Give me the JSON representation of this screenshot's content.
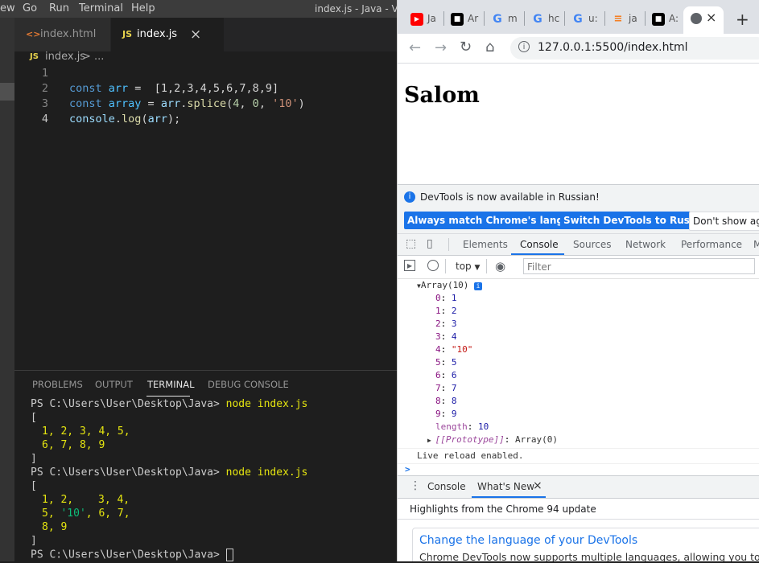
{
  "vscode": {
    "menu": [
      "ew",
      "Go",
      "Run",
      "Terminal",
      "Help"
    ],
    "window_title": "index.js - Java - Visual Studio Code",
    "tabs": [
      {
        "icon": "<>",
        "label": "index.html"
      },
      {
        "icon": "JS",
        "label": "index.js",
        "close": "×"
      }
    ],
    "breadcrumb": {
      "icon": "JS",
      "file": "index.js",
      "rest": " > ..."
    },
    "editor": {
      "line_numbers": [
        "1",
        "2",
        "3",
        "4"
      ],
      "line2": {
        "kw": "const",
        "var": "arr",
        "eq": " =  ",
        "value": "[1,2,3,4,5,6,7,8,9]"
      },
      "line3": {
        "kw": "const",
        "var": "array",
        "eq": " = ",
        "obj": "arr",
        "dot": ".",
        "fn": "splice",
        "args_open": "(",
        "a1": "4",
        "sep1": ", ",
        "a2": "0",
        "sep2": ", ",
        "a3": "'10'",
        "args_close": ")"
      },
      "line4": {
        "obj": "console",
        "dot": ".",
        "fn": "log",
        "open": "(",
        "arg": "arr",
        "close": ");"
      }
    },
    "panel_tabs": [
      "PROBLEMS",
      "OUTPUT",
      "TERMINAL",
      "DEBUG CONSOLE"
    ],
    "terminal": {
      "prompt": "PS C:\\Users\\User\\Desktop\\Java> ",
      "command": "node index.js",
      "open_bracket": "[",
      "close_bracket": "]",
      "run1_row1": "1, 2, 3, 4, 5,",
      "run1_row2": "6, 7, 8, 9",
      "run2_row1a": "1, 2,",
      "run2_row1b": "3, 4,",
      "run2_row2a": "5, ",
      "run2_row2str": "'10'",
      "run2_row2b": ", 6, 7,",
      "run2_row3": "8, 9"
    }
  },
  "chrome": {
    "tabs": [
      {
        "title": "Ja",
        "icon": "youtube-icon",
        "color": "#ff0000"
      },
      {
        "title": "Ar",
        "icon": "app-icon",
        "color": "#000000"
      },
      {
        "title": "m",
        "icon": "google-icon",
        "color": "#4285f4"
      },
      {
        "title": "hc",
        "icon": "google-icon",
        "color": "#4285f4"
      },
      {
        "title": "u:",
        "icon": "google-icon",
        "color": "#4285f4"
      },
      {
        "title": "ja",
        "icon": "stackoverflow-icon",
        "color": "#f48024"
      },
      {
        "title": "A:",
        "icon": "app-icon",
        "color": "#000000"
      }
    ],
    "active_tab_close": "×",
    "new_tab": "+",
    "url": "127.0.0.1:5500/index.html",
    "page_heading": "Salom",
    "devtools": {
      "info_text": "DevTools is now available in Russian!",
      "btn_match": "Always match Chrome's language",
      "btn_switch": "Switch DevTools to Russian",
      "btn_dont": "Don't show again",
      "tabs": [
        "Elements",
        "Console",
        "Sources",
        "Network",
        "Performance",
        "M"
      ],
      "context": "top",
      "filter_placeholder": "Filter",
      "array_header": "Array(10)",
      "entries": [
        {
          "k": "0",
          "v": "1"
        },
        {
          "k": "1",
          "v": "2"
        },
        {
          "k": "2",
          "v": "3"
        },
        {
          "k": "3",
          "v": "4"
        },
        {
          "k": "4",
          "v": "\"10\""
        },
        {
          "k": "5",
          "v": "5"
        },
        {
          "k": "6",
          "v": "6"
        },
        {
          "k": "7",
          "v": "7"
        },
        {
          "k": "8",
          "v": "8"
        },
        {
          "k": "9",
          "v": "9"
        }
      ],
      "length_key": "length",
      "length_val": "10",
      "prototype_key": "[[Prototype]]",
      "prototype_val": "Array(0)",
      "live_reload": "Live reload enabled.",
      "prompt_chevron": ">",
      "drawer_tabs": [
        "Console",
        "What's New"
      ],
      "drawer_close": "×",
      "highlights": "Highlights from the Chrome 94 update",
      "card_title": "Change the language of your DevTools",
      "card_text": "Chrome DevTools now supports multiple languages, allowing you to"
    }
  }
}
